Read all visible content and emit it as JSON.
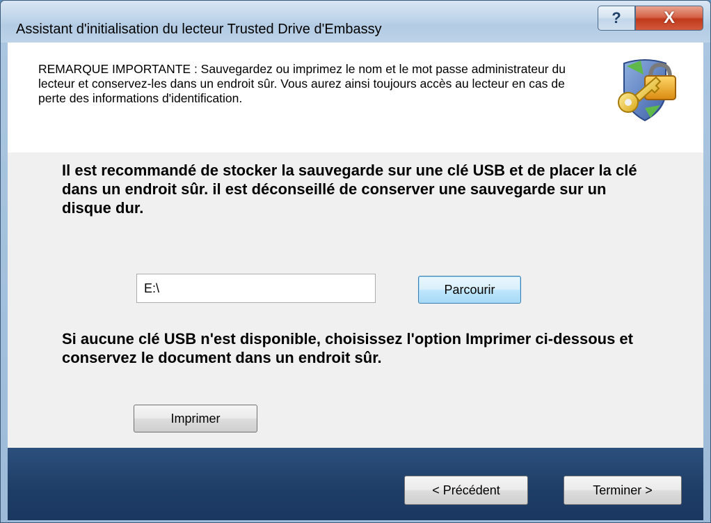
{
  "window": {
    "title": "Assistant d'initialisation du lecteur Trusted Drive d'Embassy",
    "help_label": "?",
    "close_label": "X"
  },
  "banner": {
    "text": "REMARQUE  IMPORTANTE : Sauvegardez ou imprimez le nom et le mot passe administrateur du lecteur et conservez-les dans un endroit sûr. Vous aurez ainsi toujours accès au lecteur en cas de perte des informations d'identification.",
    "icon": "security-key-lock-icon"
  },
  "main": {
    "recommendation": "Il est recommandé de stocker la sauvegarde sur une clé USB et de placer la clé dans un endroit sûr. il est déconseillé de conserver une sauvegarde sur un disque dur.",
    "path_value": "E:\\",
    "browse_label": "Parcourir",
    "no_usb_text": "Si aucune clé USB n'est disponible, choisissez l'option Imprimer ci-dessous et conservez le document dans un endroit sûr.",
    "print_label": "Imprimer"
  },
  "footer": {
    "prev_label": "< Précédent",
    "finish_label": "Terminer >"
  },
  "colors": {
    "footer": "#1e3d66",
    "close_button": "#c0391c",
    "default_button_border": "#3c7fb1"
  }
}
